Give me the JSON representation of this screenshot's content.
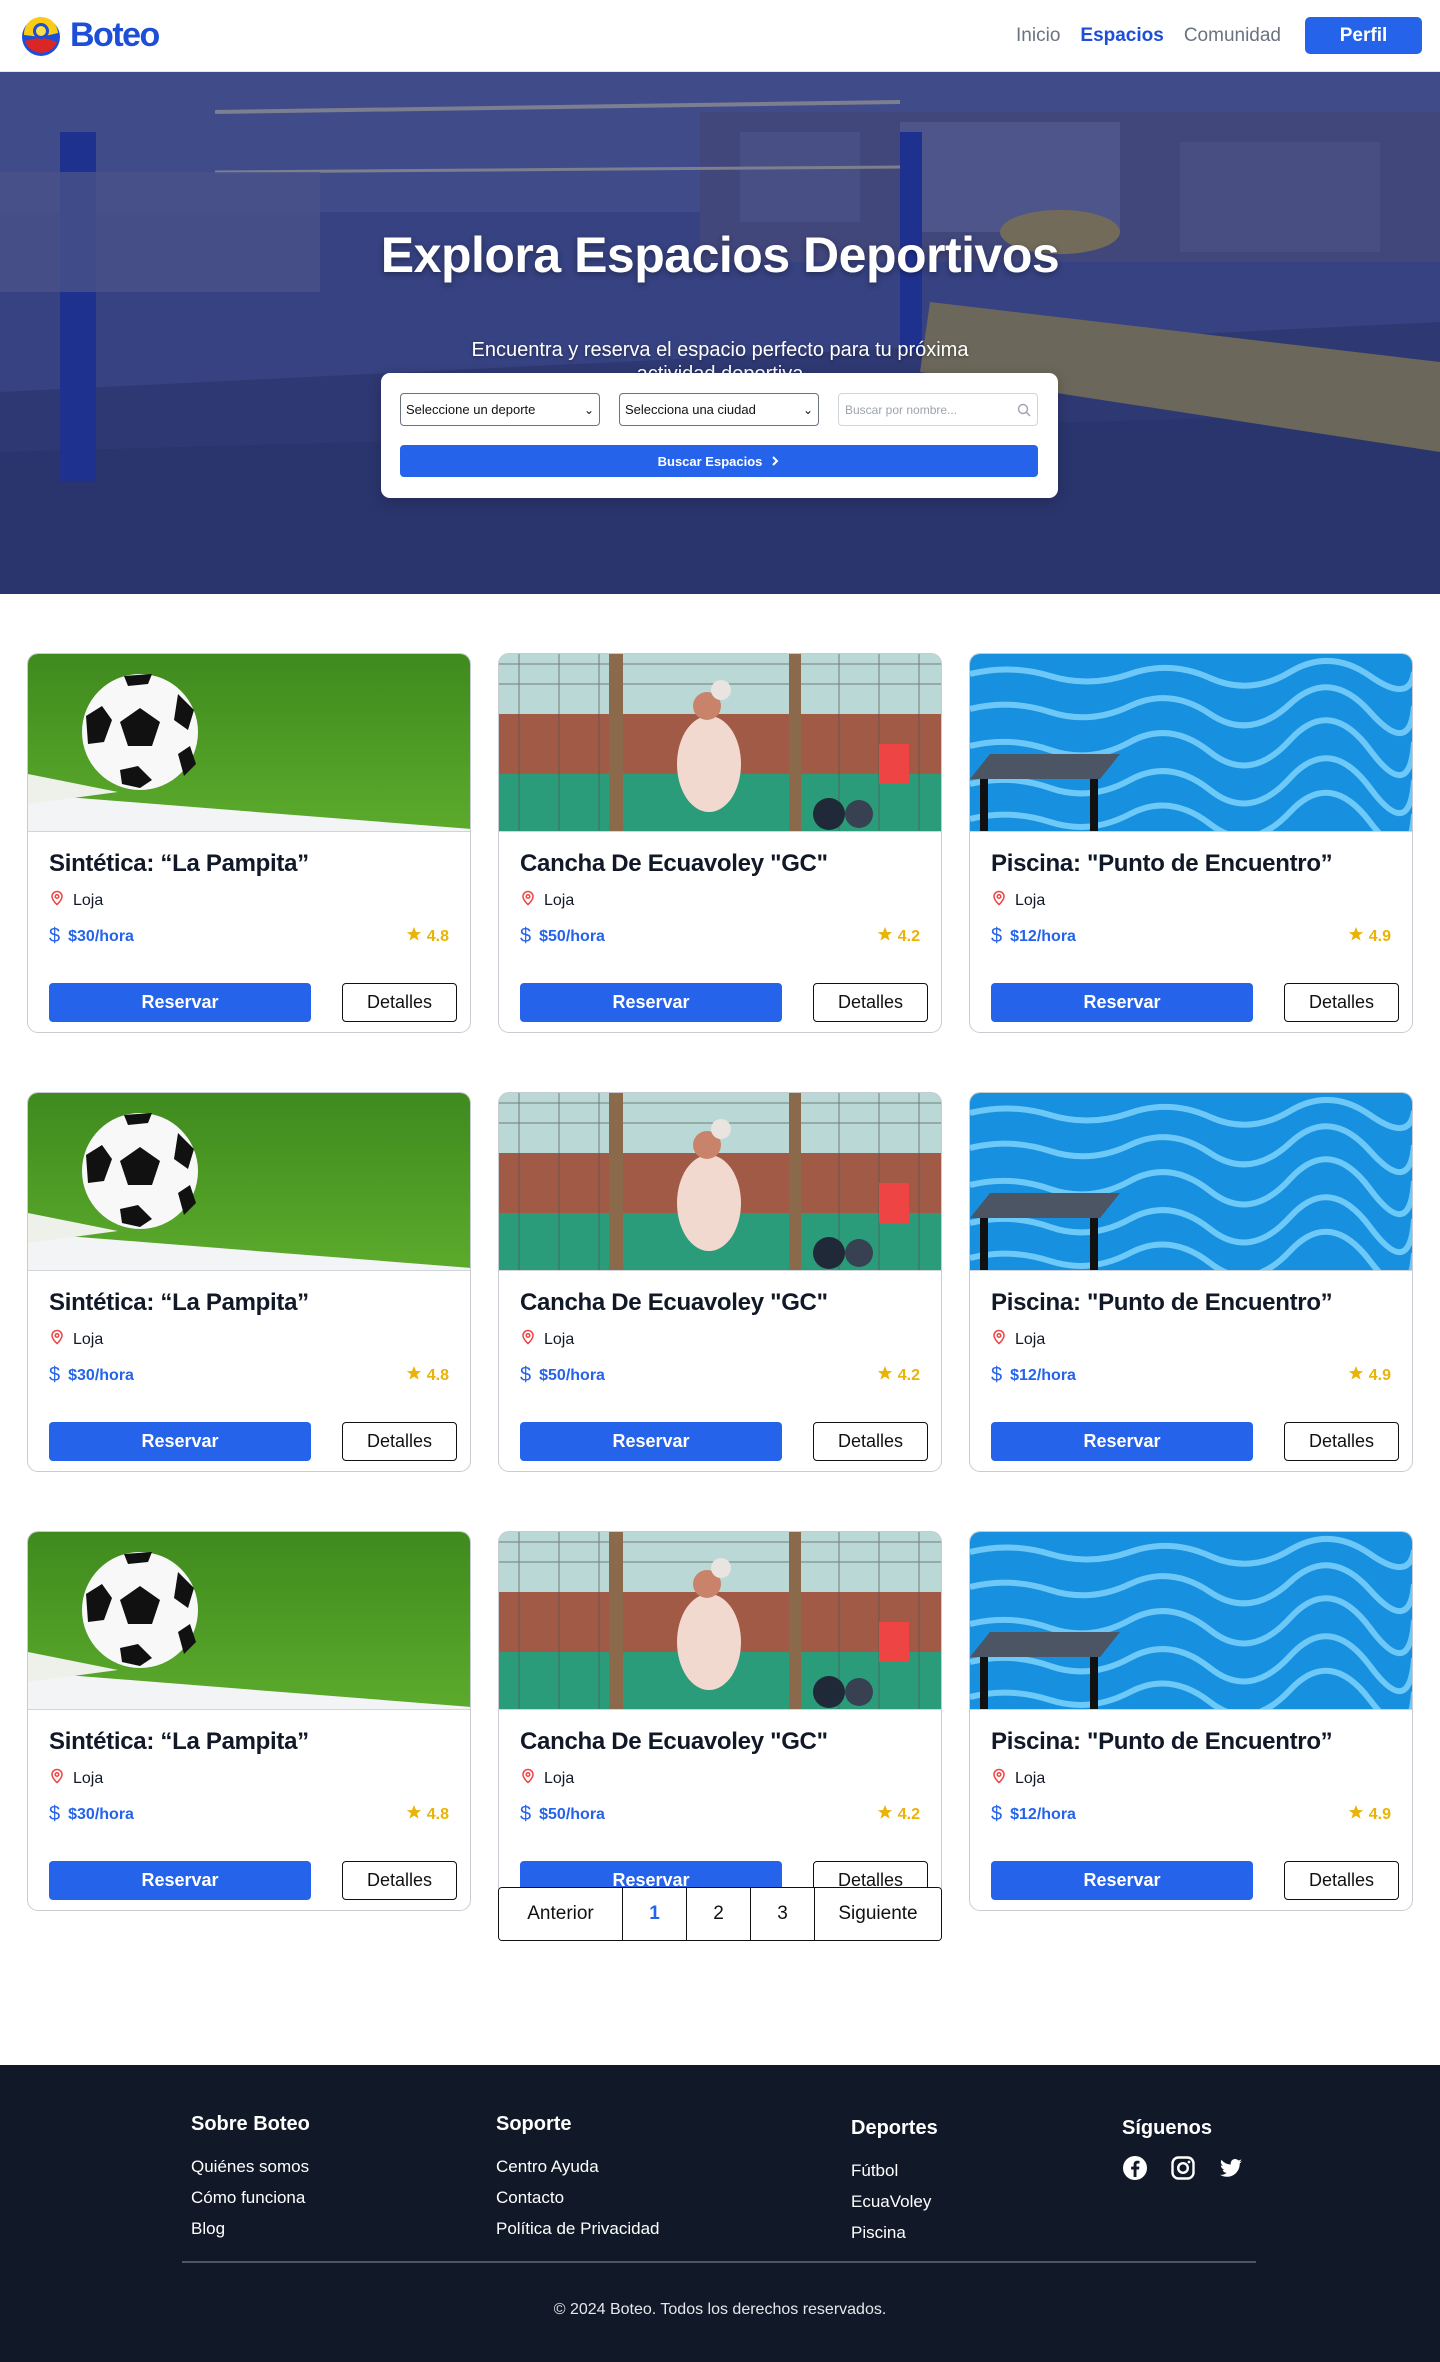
{
  "nav": {
    "brand": "Boteo",
    "links": [
      "Inicio",
      "Espacios",
      "Comunidad"
    ],
    "active_link": "Espacios",
    "profile_button": "Perfil"
  },
  "hero": {
    "title": "Explora Espacios Deportivos",
    "subtitle_line1": "Encuentra y reserva el espacio perfecto para tu próxima",
    "subtitle_line2": "actividad deportiva",
    "sport_select": "Seleccione un deporte",
    "city_select": "Selecciona una ciudad",
    "search_placeholder": "Buscar por nombre...",
    "search_button": "Buscar Espacios"
  },
  "cards": [
    {
      "title": "Sintética: “La Pampita”",
      "city": "Loja",
      "price": "$30/hora",
      "rating": "4.8",
      "image": "soccer-ball-field"
    },
    {
      "title": "Cancha De Ecuavoley \"GC\"",
      "city": "Loja",
      "price": "$50/hora",
      "rating": "4.2",
      "image": "ecuavoley-court"
    },
    {
      "title": "Piscina: \"Punto de Encuentro”",
      "city": "Loja",
      "price": "$12/hora",
      "rating": "4.9",
      "image": "swimming-pool"
    },
    {
      "title": "Sintética: “La Pampita”",
      "city": "Loja",
      "price": "$30/hora",
      "rating": "4.8",
      "image": "soccer-ball-field"
    },
    {
      "title": "Cancha De Ecuavoley \"GC\"",
      "city": "Loja",
      "price": "$50/hora",
      "rating": "4.2",
      "image": "ecuavoley-court"
    },
    {
      "title": "Piscina: \"Punto de Encuentro”",
      "city": "Loja",
      "price": "$12/hora",
      "rating": "4.9",
      "image": "swimming-pool"
    },
    {
      "title": "Sintética: “La Pampita”",
      "city": "Loja",
      "price": "$30/hora",
      "rating": "4.8",
      "image": "soccer-ball-field"
    },
    {
      "title": "Cancha De Ecuavoley \"GC\"",
      "city": "Loja",
      "price": "$50/hora",
      "rating": "4.2",
      "image": "ecuavoley-court"
    },
    {
      "title": "Piscina: \"Punto de Encuentro”",
      "city": "Loja",
      "price": "$12/hora",
      "rating": "4.9",
      "image": "swimming-pool"
    }
  ],
  "card_buttons": {
    "reserve": "Reservar",
    "details": "Detalles"
  },
  "pagination": {
    "prev": "Anterior",
    "pages": [
      "1",
      "2",
      "3"
    ],
    "current": "1",
    "next": "Siguiente"
  },
  "footer": {
    "columns": [
      {
        "heading": "Sobre Boteo",
        "links": [
          "Quiénes somos",
          "Cómo funciona",
          "Blog"
        ]
      },
      {
        "heading": "Soporte",
        "links": [
          "Centro Ayuda",
          "Contacto",
          "Política de Privacidad"
        ]
      },
      {
        "heading": "Deportes",
        "links": [
          "Fútbol",
          "EcuaVoley",
          "Piscina"
        ]
      }
    ],
    "social_heading": "Síguenos",
    "social_icons": [
      "facebook-icon",
      "instagram-icon",
      "twitter-icon"
    ],
    "copyright": "© 2024 Boteo. Todos los derechos reservados."
  },
  "colors": {
    "primary": "#2563eb",
    "star": "#eab308",
    "footer_bg": "#111827",
    "pin": "#ef4444"
  }
}
